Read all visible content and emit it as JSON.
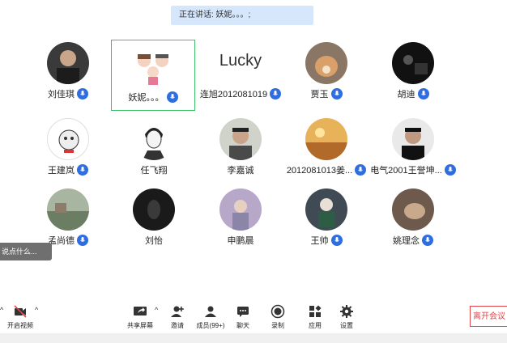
{
  "speaking": "正在讲话: 妖妮。。。;",
  "participants": [
    {
      "name": "刘佳琪"
    },
    {
      "name": "妖妮。。。"
    },
    {
      "name": "连旭2012081019",
      "avatar_text": "Lucky"
    },
    {
      "name": "贾玉"
    },
    {
      "name": "胡迪"
    },
    {
      "name": "王建岚"
    },
    {
      "name": "任飞翔"
    },
    {
      "name": "李嘉诚"
    },
    {
      "name": "2012081013姜..."
    },
    {
      "name": "电气2001王誉坤..."
    },
    {
      "name": "孟尚德"
    },
    {
      "name": "刘怡"
    },
    {
      "name": "申鹏晨"
    },
    {
      "name": "王帅"
    },
    {
      "name": "姚理念"
    }
  ],
  "chat_preview": "说点什么...",
  "toolbar": {
    "video": "开启视频",
    "share": "共享屏幕",
    "invite": "邀请",
    "members": "成员(99+)",
    "chat": "聊天",
    "record": "录制",
    "apps": "应用",
    "settings": "设置"
  },
  "leave": "离开会议",
  "colors": {
    "accent": "#2f6ee0",
    "highlight": "#3fbf6a",
    "leave": "#e0454a",
    "banner": "#d6e6fb"
  }
}
